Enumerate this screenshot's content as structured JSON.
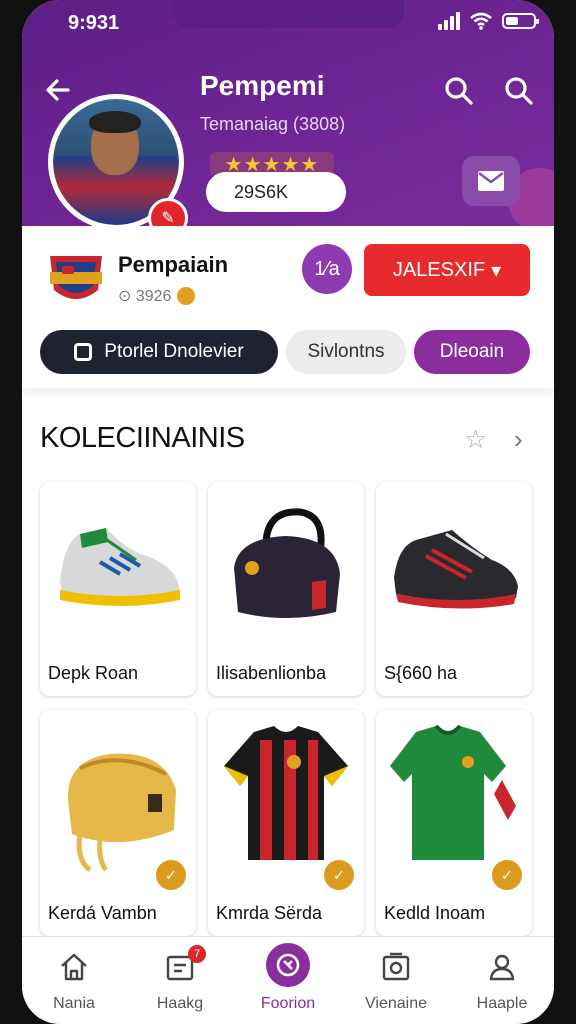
{
  "status_bar": {
    "time": "9:931"
  },
  "header": {
    "title": "Pempemi",
    "subtitle": "Temanaiag (3808)",
    "stars": "★★★★★",
    "followers": "29S6K"
  },
  "club": {
    "name": "Pempaiain",
    "meta": "⊙ 3926"
  },
  "actions": {
    "round_label": "1⁄a",
    "select_label": "JALESXIF",
    "select_chevron": "▾"
  },
  "tabs": [
    {
      "label": "Ptorlel Dnolevier"
    },
    {
      "label": "Sivlontns"
    },
    {
      "label": "Dleoain"
    }
  ],
  "collection": {
    "title": "KOLECIINAINIS",
    "items": [
      {
        "label": "Depk Roan"
      },
      {
        "label": "Ilisabenlionba"
      },
      {
        "label": "S{660 ha"
      },
      {
        "label": "Kerdá Vambn"
      },
      {
        "label": "Kmrda Sërda"
      },
      {
        "label": "Kedld Inoam"
      }
    ]
  },
  "bottom_nav": [
    {
      "label": "Nania",
      "icon": "home-icon"
    },
    {
      "label": "Haakg",
      "icon": "messages-icon",
      "badge": "7"
    },
    {
      "label": "Foorion",
      "icon": "favorites-icon"
    },
    {
      "label": "Vienaine",
      "icon": "gallery-icon"
    },
    {
      "label": "Haaple",
      "icon": "profile-icon"
    }
  ],
  "colors": {
    "header_purple": "#6f2595",
    "accent_purple": "#8a2e9e",
    "accent_red": "#e62a2e",
    "gold": "#d99a1e"
  }
}
